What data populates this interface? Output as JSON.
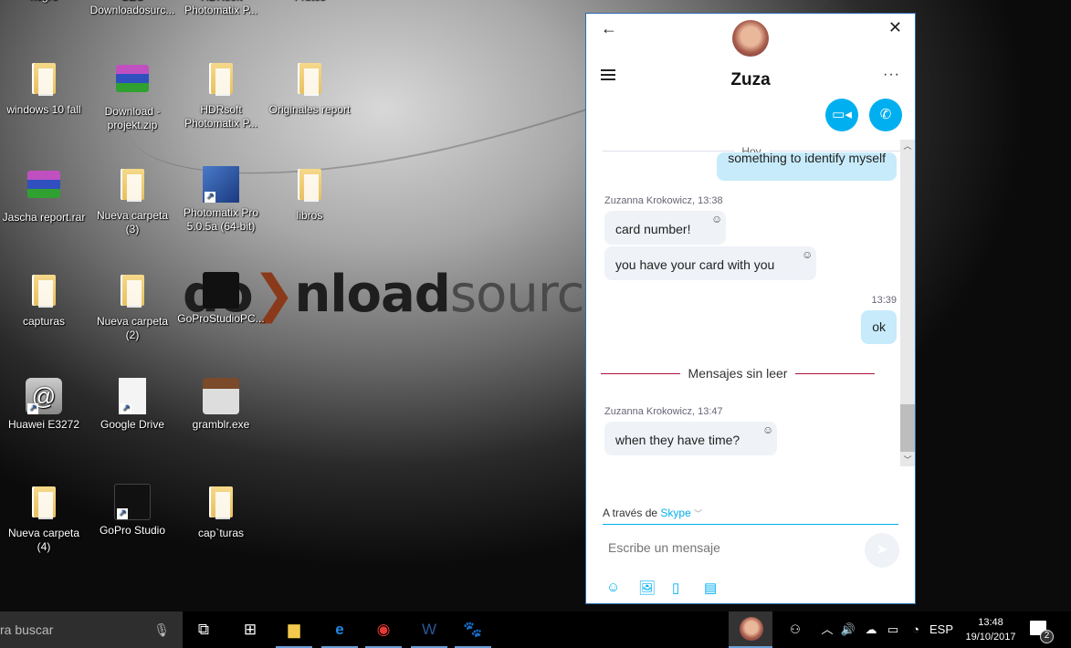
{
  "desktop": {
    "watermark": {
      "bold": "do",
      "rest_bold": "nload",
      "light": "source"
    },
    "icons": [
      {
        "label": "negro",
        "type": "folder"
      },
      {
        "label": "SEO Downloadosurc...",
        "type": "folder"
      },
      {
        "label": "HDRsoft Photomatix P...",
        "type": "folder"
      },
      {
        "label": "Frutes",
        "type": "folder"
      },
      {
        "label": "windows 10 fall",
        "type": "folder"
      },
      {
        "label": "Download - projekt.zip",
        "type": "archive"
      },
      {
        "label": "HDRsoft Photomatix P...",
        "type": "folder"
      },
      {
        "label": "Originales report",
        "type": "folder"
      },
      {
        "label": "Jascha report.rar",
        "type": "archive"
      },
      {
        "label": "Nueva carpeta (3)",
        "type": "folder"
      },
      {
        "label": "Photomatix Pro 5.0.5a (64-bit)",
        "type": "shortcut"
      },
      {
        "label": "libros",
        "type": "folder"
      },
      {
        "label": "capturas",
        "type": "folder"
      },
      {
        "label": "Nueva carpeta (2)",
        "type": "folder"
      },
      {
        "label": "GoProStudioPC...",
        "type": "installer"
      },
      {
        "label": "Huawei E3272",
        "type": "shortcut"
      },
      {
        "label": "Google Drive",
        "type": "shortcut"
      },
      {
        "label": "gramblr.exe",
        "type": "app"
      },
      {
        "label": "Nueva carpeta (4)",
        "type": "folder"
      },
      {
        "label": "GoPro Studio",
        "type": "shortcut"
      },
      {
        "label": "cap`turas",
        "type": "folder"
      }
    ]
  },
  "skype": {
    "contact_name": "Zuza",
    "icons": {
      "back": "←",
      "close": "✕",
      "more": "···",
      "video": "▭◂",
      "phone": "✆"
    },
    "date_divider": "Hoy",
    "messages": [
      {
        "direction": "out",
        "text": "something to identify myself"
      },
      {
        "direction": "in",
        "meta": "Zuzanna Krokowicz, 13:38",
        "text": "card number!"
      },
      {
        "direction": "in",
        "text": "you have your card with you"
      },
      {
        "direction": "out",
        "meta": "13:39",
        "text": "ok"
      },
      {
        "direction": "in",
        "meta": "Zuzanna Krokowicz, 13:47",
        "text": "when they have time?"
      }
    ],
    "unread_divider": "Mensajes sin leer",
    "via_label": "A través de",
    "via_service": "Skype",
    "input_placeholder": "Escribe un mensaje",
    "accent_color": "#00aff0",
    "unread_color": "#b0123a"
  },
  "taskbar": {
    "search_text": "ra buscar",
    "language": "ESP",
    "time": "13:48",
    "date": "19/10/2017",
    "notification_count": "2"
  }
}
